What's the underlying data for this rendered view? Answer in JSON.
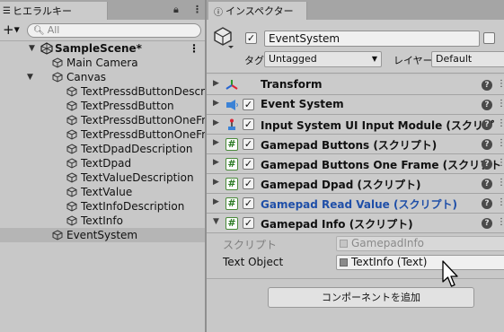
{
  "hierarchy": {
    "tab_label": "ヒエラルキー",
    "tab_icon": "list-icon",
    "lock_icon": "lock-icon",
    "menu_icon": "kebab-menu-icon",
    "add_icon": "+",
    "search_placeholder": "All",
    "scene_name": "SampleScene*",
    "items": [
      {
        "label": "Main Camera",
        "depth": 1,
        "expand": ""
      },
      {
        "label": "Canvas",
        "depth": 1,
        "expand": "open"
      },
      {
        "label": "TextPressdButtonDescri",
        "depth": 2,
        "expand": ""
      },
      {
        "label": "TextPressdButton",
        "depth": 2,
        "expand": ""
      },
      {
        "label": "TextPressdButtonOneFr",
        "depth": 2,
        "expand": ""
      },
      {
        "label": "TextPressdButtonOneFr",
        "depth": 2,
        "expand": ""
      },
      {
        "label": "TextDpadDescription",
        "depth": 2,
        "expand": ""
      },
      {
        "label": "TextDpad",
        "depth": 2,
        "expand": ""
      },
      {
        "label": "TextValueDescription",
        "depth": 2,
        "expand": ""
      },
      {
        "label": "TextValue",
        "depth": 2,
        "expand": ""
      },
      {
        "label": "TextInfoDescription",
        "depth": 2,
        "expand": ""
      },
      {
        "label": "TextInfo",
        "depth": 2,
        "expand": ""
      },
      {
        "label": "EventSystem",
        "depth": 1,
        "expand": "",
        "selected": true
      }
    ]
  },
  "inspector": {
    "tab_label": "インスペクター",
    "tab_icon": "info-icon",
    "object_name": "EventSystem",
    "active": true,
    "static": false,
    "tag_label": "タグ",
    "tag_value": "Untagged",
    "layer_label": "レイヤー",
    "layer_value": "Default",
    "components": [
      {
        "title": "Transform",
        "icon": "transform-icon",
        "has_checkbox": false,
        "expanded": false,
        "highlight": false
      },
      {
        "title": "Event System",
        "icon": "event-system-icon",
        "has_checkbox": true,
        "expanded": false,
        "highlight": false
      },
      {
        "title": "Input System UI Input Module (スクリプ",
        "icon": "input-module-icon",
        "has_checkbox": true,
        "expanded": false,
        "highlight": false
      },
      {
        "title": "Gamepad Buttons (スクリプト)",
        "icon": "script-icon",
        "has_checkbox": true,
        "expanded": false,
        "highlight": false
      },
      {
        "title": "Gamepad Buttons One Frame (スクリプト",
        "icon": "script-icon",
        "has_checkbox": true,
        "expanded": false,
        "highlight": false
      },
      {
        "title": "Gamepad Dpad (スクリプト)",
        "icon": "script-icon",
        "has_checkbox": true,
        "expanded": false,
        "highlight": false
      },
      {
        "title": "Gamepad Read Value (スクリプト)",
        "icon": "script-icon",
        "has_checkbox": true,
        "expanded": false,
        "highlight": true
      },
      {
        "title": "Gamepad Info (スクリプト)",
        "icon": "script-icon",
        "has_checkbox": true,
        "expanded": true,
        "highlight": false
      }
    ],
    "script_label": "スクリプト",
    "script_value": "GamepadInfo",
    "text_object_label": "Text Object",
    "text_object_value": "TextInfo (Text)",
    "add_component_label": "コンポーネントを追加"
  },
  "colors": {
    "panel_bg": "#c8c8c8",
    "selection": "#b5b5b5",
    "link_blue": "#1f4fa8",
    "script_green": "#2a7a22"
  }
}
